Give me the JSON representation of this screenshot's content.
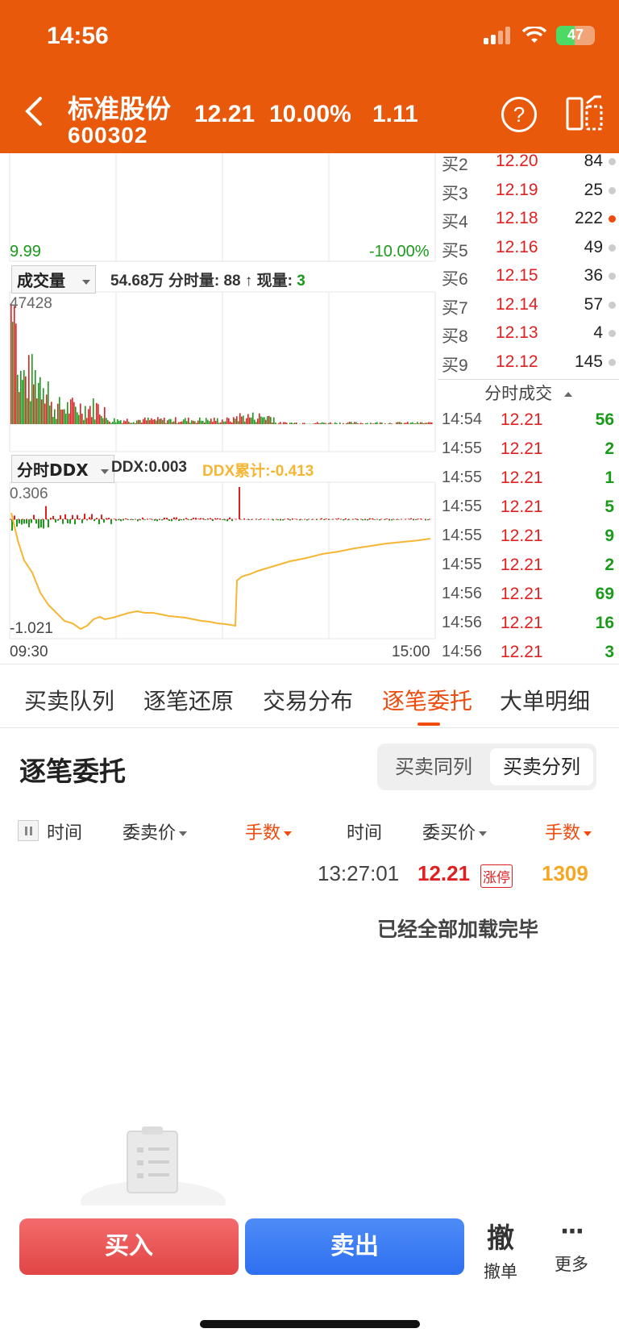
{
  "status_bar": {
    "time": "14:56",
    "battery": "47",
    "battery_level": 0.47
  },
  "header": {
    "stock_name": "标准股份",
    "stock_code": "600302",
    "price": "12.21",
    "change_pct": "10.00%",
    "change_amt": "1.11",
    "colors": {
      "bg": "#e8590c"
    }
  },
  "price_chart": {
    "low_price": "9.99",
    "low_pct": "-10.00%"
  },
  "volume_panel": {
    "selector": "成交量",
    "total": "54.68万",
    "tick_label": "分时量:",
    "tick_value": "88",
    "now_label": "现量:",
    "now_value": "3",
    "max_label": "47428"
  },
  "ddx_panel": {
    "selector": "分时DDX",
    "ddx_text": "DDX:0.003",
    "cum_text": "DDX累计:-0.413",
    "top_label": "0.306",
    "bottom_label": "-1.021",
    "start_time": "09:30",
    "end_time": "15:00"
  },
  "order_book": [
    {
      "level": "买2",
      "price": "12.20",
      "qty": "84",
      "dot_color": "#cccccc"
    },
    {
      "level": "买3",
      "price": "12.19",
      "qty": "25",
      "dot_color": "#cccccc"
    },
    {
      "level": "买4",
      "price": "12.18",
      "qty": "222",
      "dot_color": "#f04a0c"
    },
    {
      "level": "买5",
      "price": "12.16",
      "qty": "49",
      "dot_color": "#cccccc"
    },
    {
      "level": "买6",
      "price": "12.15",
      "qty": "36",
      "dot_color": "#cccccc"
    },
    {
      "level": "买7",
      "price": "12.14",
      "qty": "57",
      "dot_color": "#cccccc"
    },
    {
      "level": "买8",
      "price": "12.13",
      "qty": "4",
      "dot_color": "#cccccc"
    },
    {
      "level": "买9",
      "price": "12.12",
      "qty": "145",
      "dot_color": "#cccccc"
    }
  ],
  "trades_title": "分时成交",
  "trades": [
    {
      "time": "14:54",
      "price": "12.21",
      "vol": "56"
    },
    {
      "time": "14:55",
      "price": "12.21",
      "vol": "2"
    },
    {
      "time": "14:55",
      "price": "12.21",
      "vol": "1"
    },
    {
      "time": "14:55",
      "price": "12.21",
      "vol": "5"
    },
    {
      "time": "14:55",
      "price": "12.21",
      "vol": "9"
    },
    {
      "time": "14:55",
      "price": "12.21",
      "vol": "2"
    },
    {
      "time": "14:56",
      "price": "12.21",
      "vol": "69"
    },
    {
      "time": "14:56",
      "price": "12.21",
      "vol": "16"
    },
    {
      "time": "14:56",
      "price": "12.21",
      "vol": "3"
    }
  ],
  "tabs": [
    {
      "label": "买卖队列"
    },
    {
      "label": "逐笔还原"
    },
    {
      "label": "交易分布"
    },
    {
      "label": "逐笔委托",
      "active": true
    },
    {
      "label": "大单明细"
    }
  ],
  "section": {
    "title": "逐笔委托",
    "toggle": [
      "买卖同列",
      "买卖分列"
    ],
    "toggle_selected": "买卖分列"
  },
  "columns": {
    "left": [
      "时间",
      "委卖价",
      "手数"
    ],
    "right": [
      "时间",
      "委买价",
      "手数"
    ]
  },
  "entry": {
    "time": "13:27:01",
    "price": "12.21",
    "badge": "涨停",
    "qty": "1309"
  },
  "loaded_text": "已经全部加载完毕",
  "bottom_bar": {
    "buy": "买入",
    "sell": "卖出",
    "cancel_glyph": "撤",
    "cancel": "撤单",
    "more_glyph": "···",
    "more": "更多"
  }
}
